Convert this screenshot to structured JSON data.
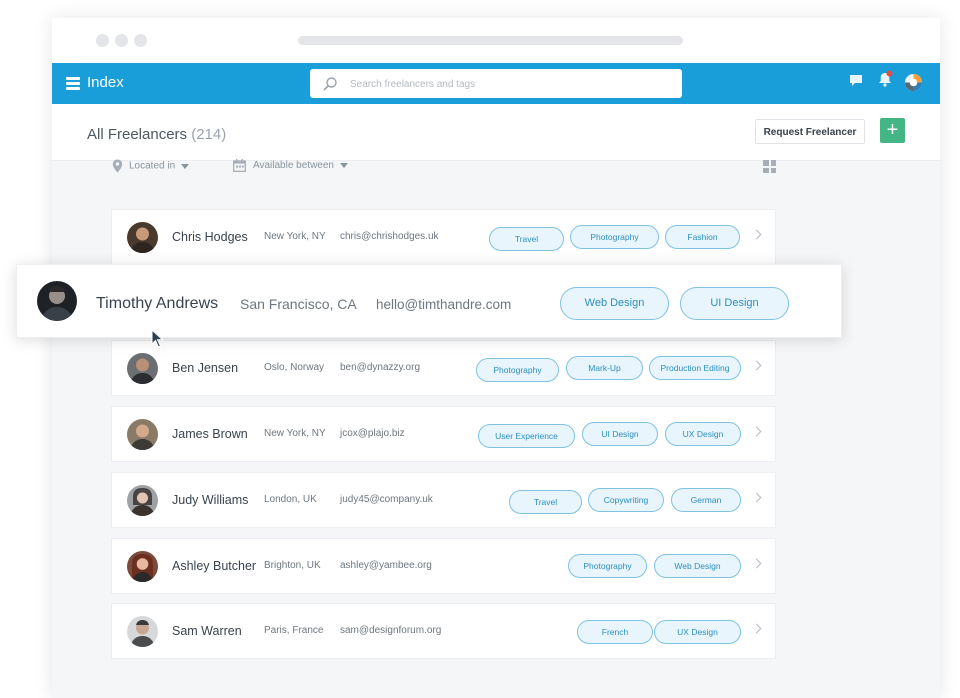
{
  "app": {
    "title": "Index"
  },
  "search": {
    "placeholder": "Search freelancers and tags"
  },
  "header": {
    "title": "All Freelancers",
    "count": "(214)"
  },
  "actions": {
    "request_label": "Request Freelancer",
    "add_label": "+"
  },
  "filters": {
    "location": "Located in",
    "availability": "Available between"
  },
  "colors": {
    "appbar": "#1a9ed9",
    "add_button": "#44b584",
    "tag_border": "#7fc2e3",
    "tag_fill": "#e8f5fc",
    "notification": "#e74c3c"
  },
  "rows": [
    {
      "name": "Chris Hodges",
      "location": "New York, NY",
      "email": "chris@chrishodges.uk",
      "tags": [
        "Travel",
        "Photography",
        "Fashion"
      ]
    },
    {
      "name": "Ben Jensen",
      "location": "Oslo, Norway",
      "email": "ben@dynazzy.org",
      "tags": [
        "Photography",
        "Mark-Up",
        "Production Editing"
      ]
    },
    {
      "name": "James Brown",
      "location": "New York, NY",
      "email": "jcox@plajo.biz",
      "tags": [
        "User Experience",
        "UI Design",
        "UX Design"
      ]
    },
    {
      "name": "Judy Williams",
      "location": "London, UK",
      "email": "judy45@company.uk",
      "tags": [
        "Travel",
        "Copywriting",
        "German"
      ]
    },
    {
      "name": "Ashley Butcher",
      "location": "Brighton, UK",
      "email": "ashley@yambee.org",
      "tags": [
        "Photography",
        "Web Design"
      ]
    },
    {
      "name": "Sam Warren",
      "location": "Paris, France",
      "email": "sam@designforum.org",
      "tags": [
        "French",
        "UX Design"
      ]
    }
  ],
  "featured": {
    "name": "Timothy Andrews",
    "location": "San Francisco, CA",
    "email": "hello@timthandre.com",
    "tags": [
      "Web Design",
      "UI Design"
    ]
  }
}
